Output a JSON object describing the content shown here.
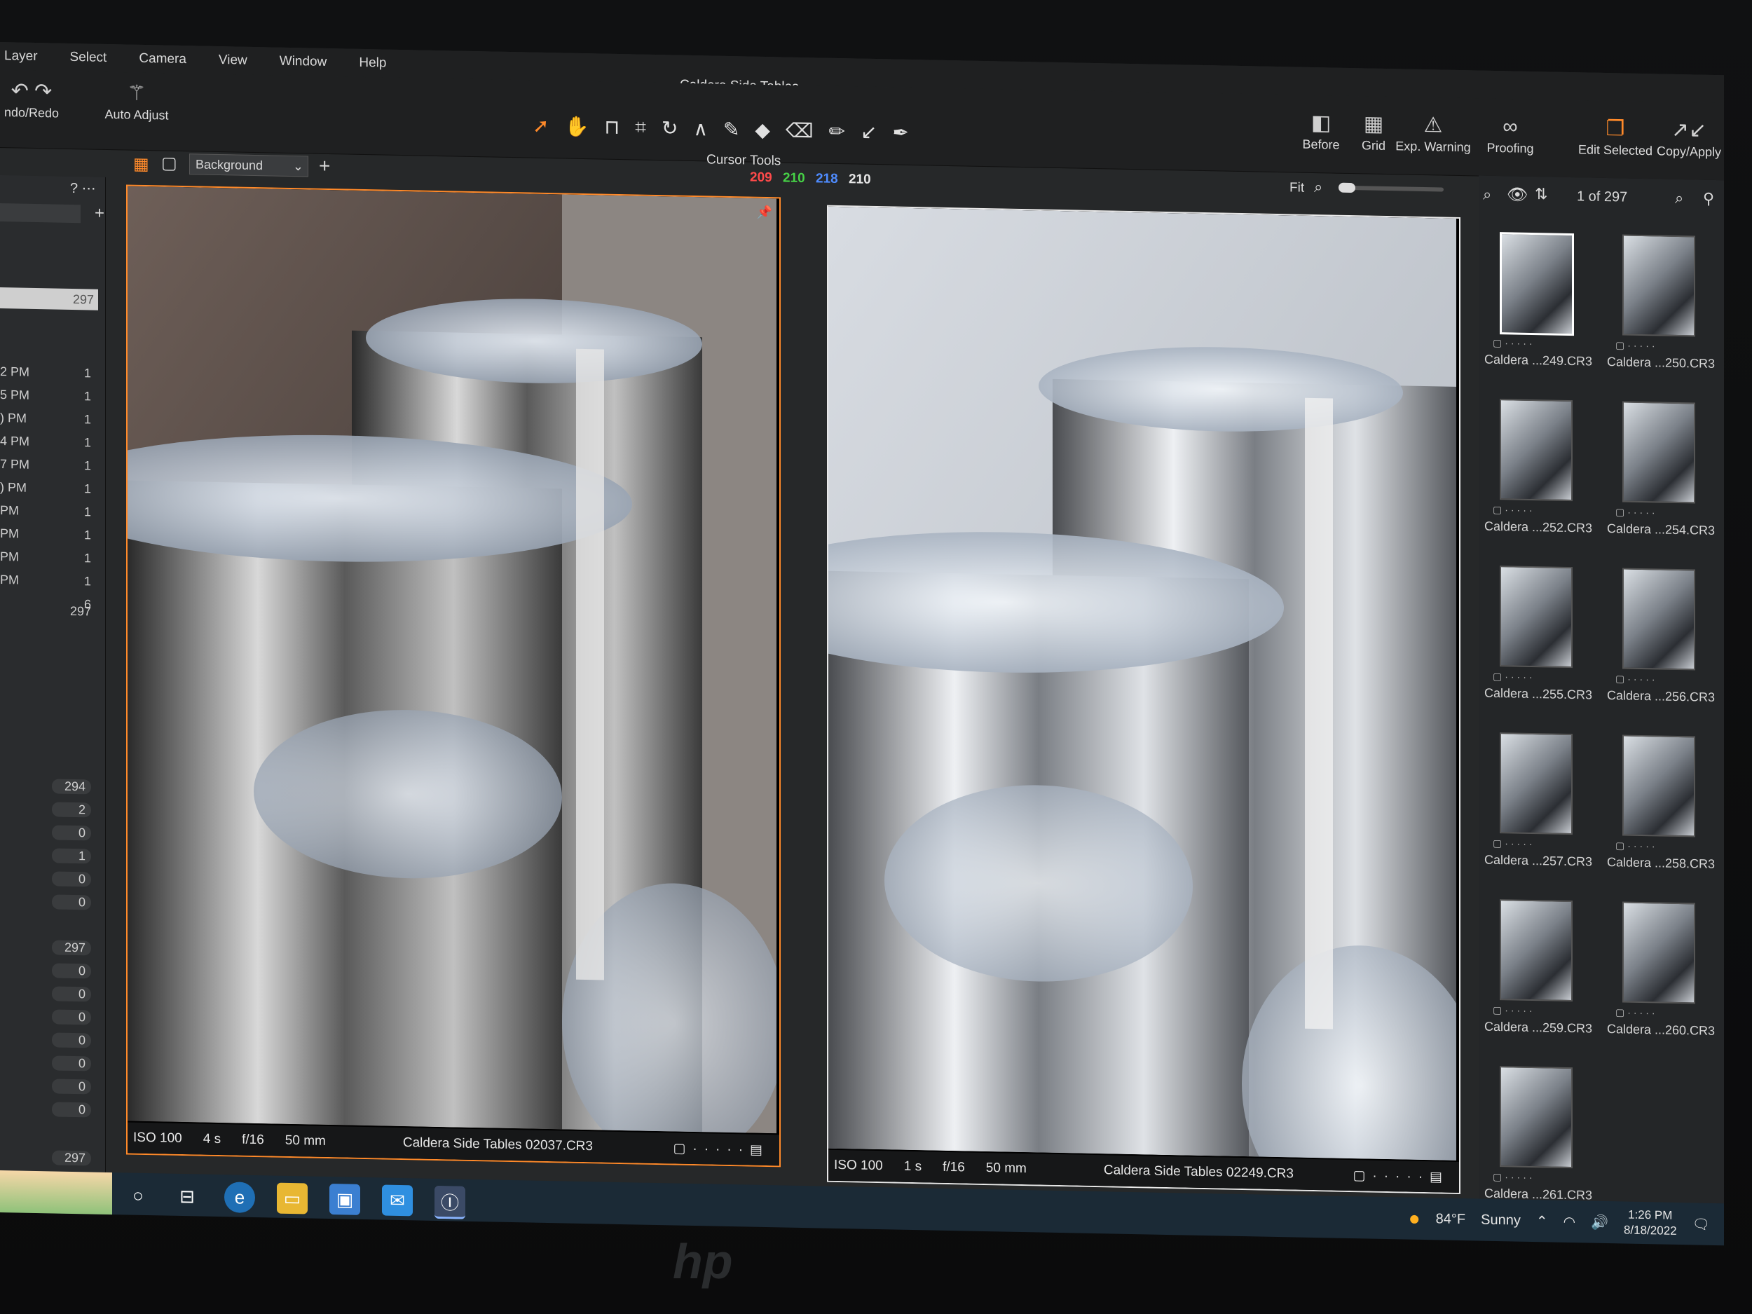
{
  "app": {
    "title": "Caldera Side Tables"
  },
  "menu": {
    "items": [
      "Layer",
      "Select",
      "Camera",
      "View",
      "Window",
      "Help"
    ]
  },
  "toolbar": {
    "undo_redo_label": "ndo/Redo",
    "auto_adjust_label": "Auto Adjust",
    "cursor_tools_label": "Cursor Tools",
    "before_label": "Before",
    "grid_label": "Grid",
    "exp_warning_label": "Exp. Warning",
    "proofing_label": "Proofing",
    "edit_selected_label": "Edit Selected",
    "copy_apply_label": "Copy/Apply"
  },
  "viewer_bar": {
    "layer": "Background",
    "rgb": {
      "r": "209",
      "g": "210",
      "b": "218",
      "a": "210"
    },
    "fit_label": "Fit"
  },
  "left_panel": {
    "top_count": "297",
    "rows": [
      {
        "label": "2 PM",
        "count": "1"
      },
      {
        "label": "5 PM",
        "count": "1"
      },
      {
        "label": ") PM",
        "count": "1"
      },
      {
        "label": "4 PM",
        "count": "1"
      },
      {
        "label": "7 PM",
        "count": "1"
      },
      {
        "label": ") PM",
        "count": "1"
      },
      {
        "label": "PM",
        "count": "1"
      },
      {
        "label": "PM",
        "count": "1"
      },
      {
        "label": "PM",
        "count": "1"
      },
      {
        "label": "PM",
        "count": "1"
      },
      {
        "label": "",
        "count": "6"
      }
    ],
    "mid_count": "297",
    "counts": [
      "294",
      "2",
      "0",
      "1",
      "0",
      "0"
    ],
    "counts2": [
      "297",
      "0",
      "0",
      "0",
      "0",
      "0",
      "0",
      "0"
    ],
    "bottom_count": "297"
  },
  "viewer_left": {
    "iso": "ISO 100",
    "shutter": "4 s",
    "aperture": "f/16",
    "focal": "50 mm",
    "filename": "Caldera Side Tables 02037.CR3"
  },
  "viewer_right": {
    "iso": "ISO 100",
    "shutter": "1 s",
    "aperture": "f/16",
    "focal": "50 mm",
    "filename": "Caldera Side Tables 02249.CR3"
  },
  "browser": {
    "position": "1 of 297",
    "thumbs": [
      "Caldera ...249.CR3",
      "Caldera ...250.CR3",
      "Caldera ...252.CR3",
      "Caldera ...254.CR3",
      "Caldera ...255.CR3",
      "Caldera ...256.CR3",
      "Caldera ...257.CR3",
      "Caldera ...258.CR3",
      "Caldera ...259.CR3",
      "Caldera ...260.CR3",
      "Caldera ...261.CR3"
    ]
  },
  "tray": {
    "temp": "84°F",
    "weather": "Sunny",
    "time": "1:26 PM",
    "date": "8/18/2022"
  },
  "bezel": {
    "logo": "hp"
  },
  "colors": {
    "accent": "#ff8a2a",
    "red": "#ff4a4a",
    "green": "#46d146",
    "blue": "#4f8cff"
  }
}
